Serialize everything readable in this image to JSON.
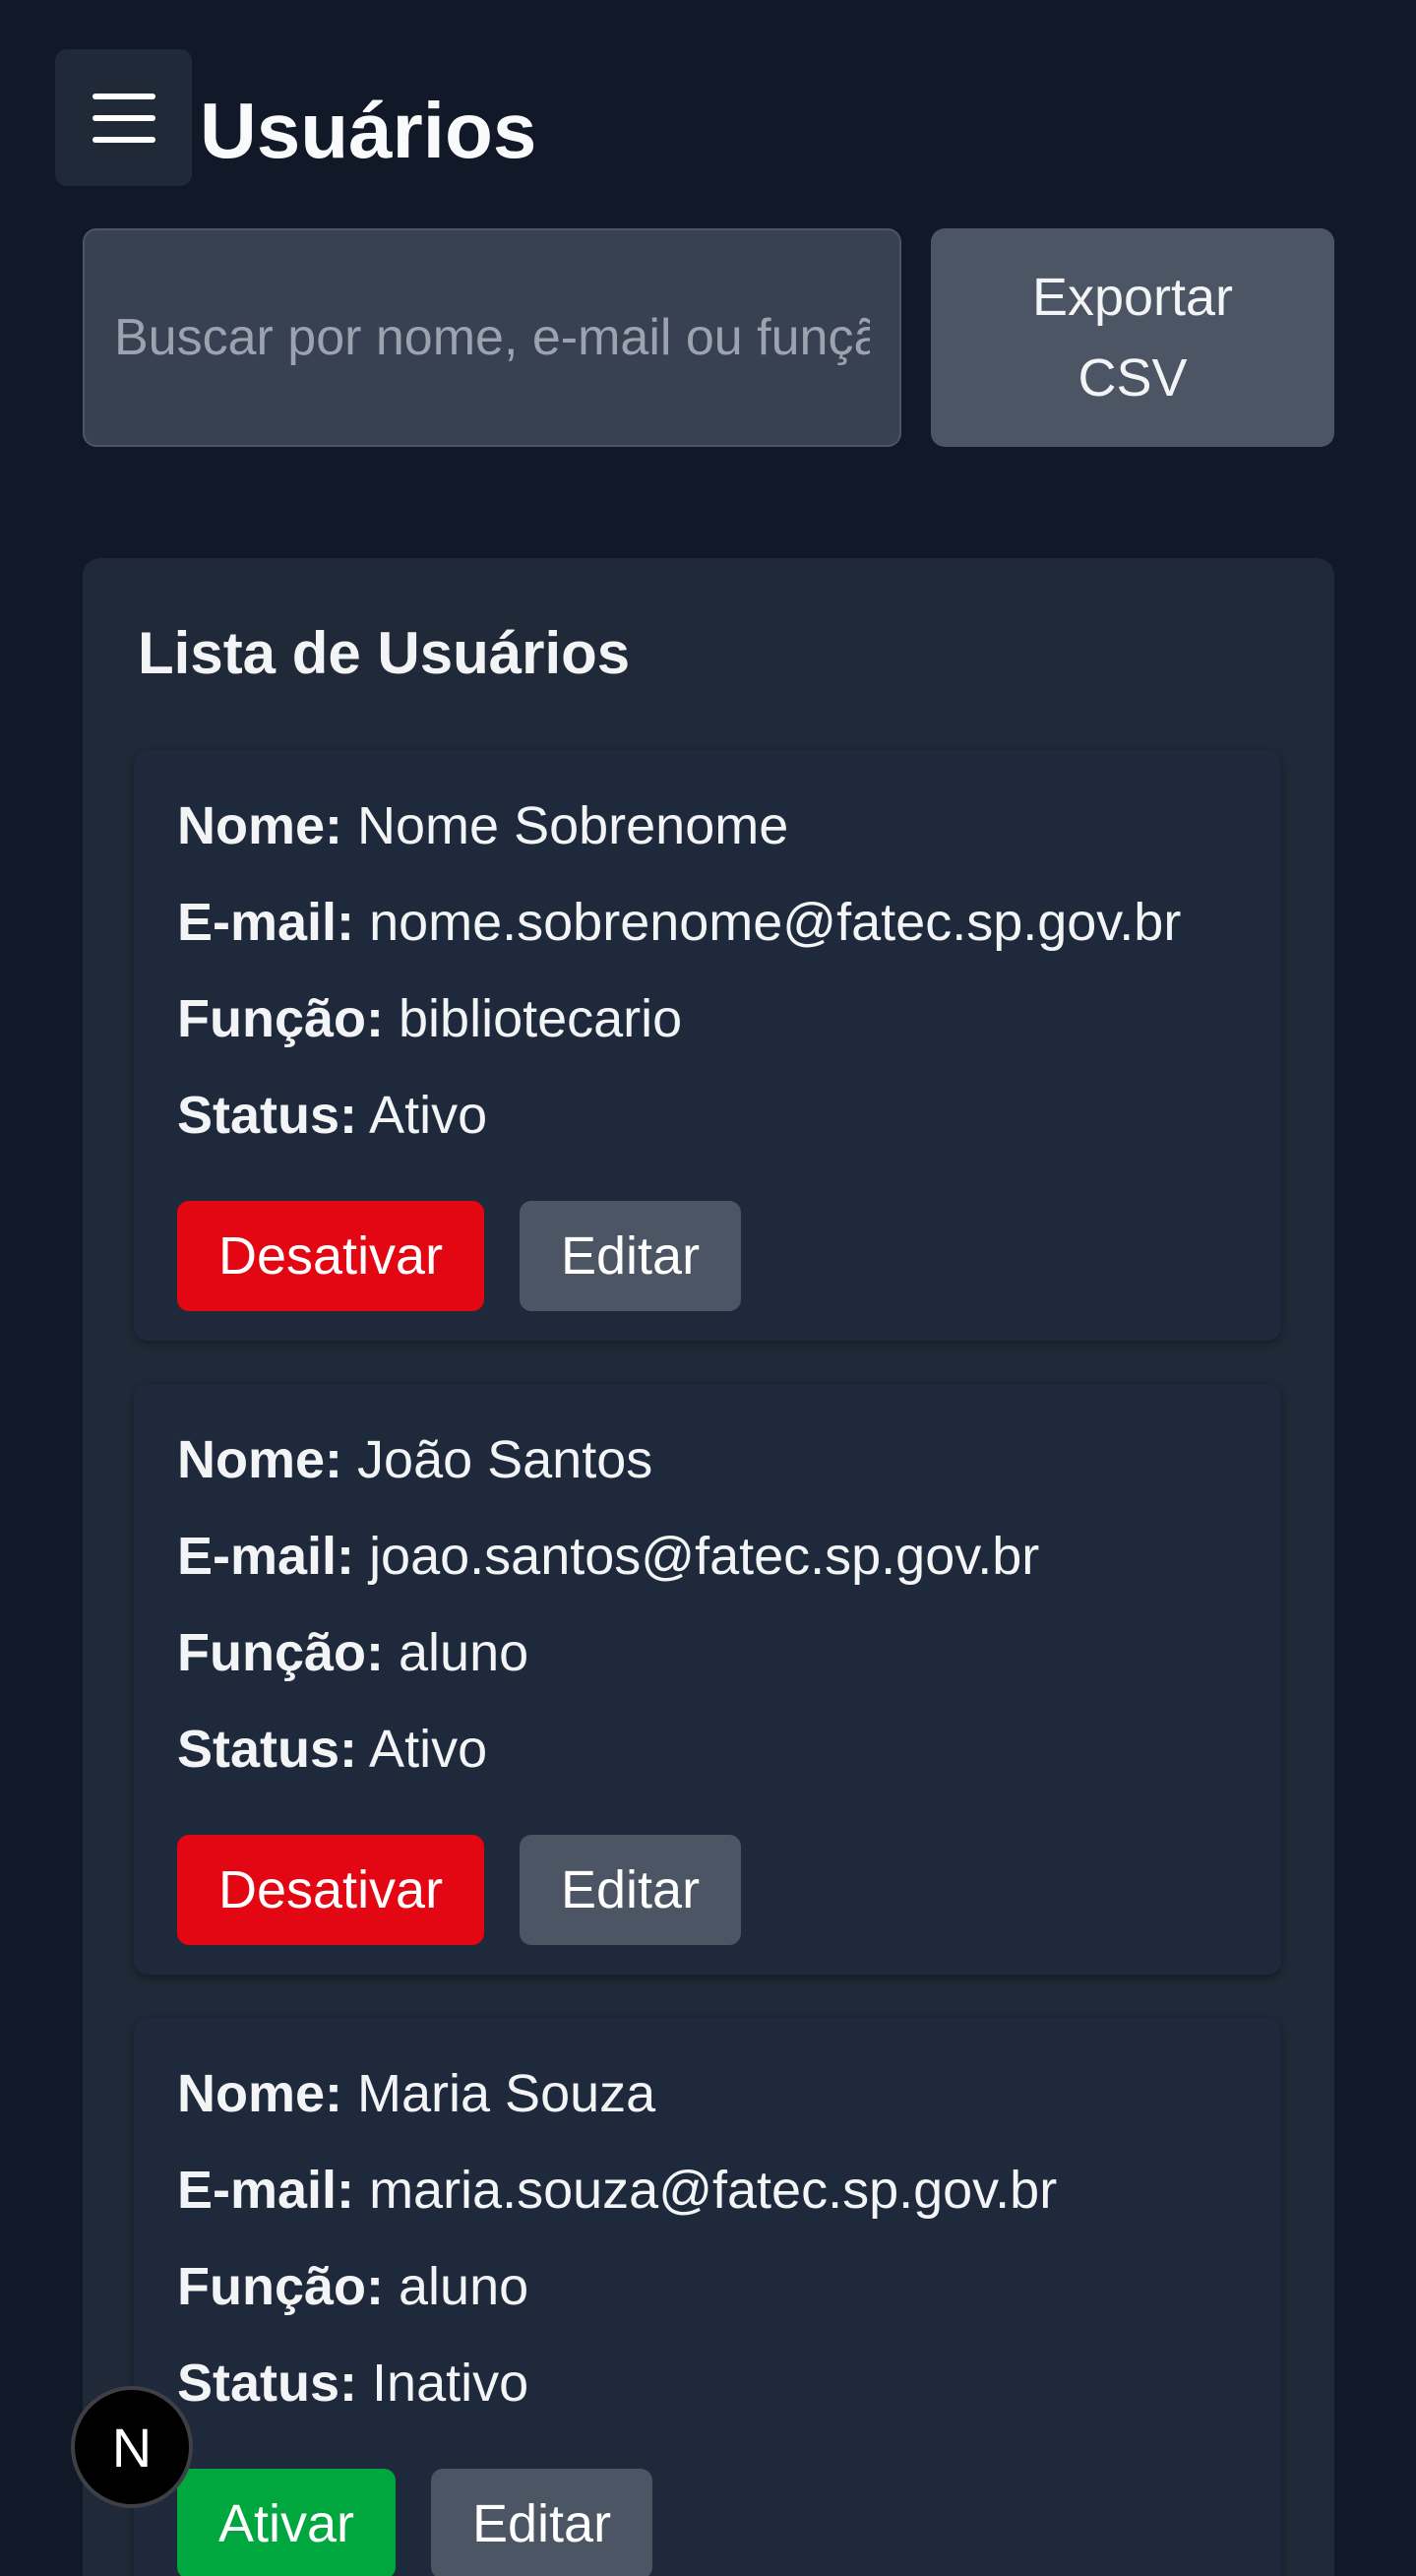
{
  "header": {
    "menu_icon": "hamburger-menu-icon",
    "title": "Usuários"
  },
  "toolbar": {
    "search_placeholder": "Buscar por nome, e-mail ou função",
    "export_label": "Exportar CSV"
  },
  "list": {
    "title": "Lista de Usuários",
    "labels": {
      "name": "Nome:",
      "email": "E-mail:",
      "role": "Função:",
      "status": "Status:"
    },
    "users": [
      {
        "name": "Nome Sobrenome",
        "email": "nome.sobrenome@fatec.sp.gov.br",
        "role": "bibliotecario",
        "status": "Ativo",
        "toggle_label": "Desativar",
        "edit_label": "Editar"
      },
      {
        "name": "João Santos",
        "email": "joao.santos@fatec.sp.gov.br",
        "role": "aluno",
        "status": "Ativo",
        "toggle_label": "Desativar",
        "edit_label": "Editar"
      },
      {
        "name": "Maria Souza",
        "email": "maria.souza@fatec.sp.gov.br",
        "role": "aluno",
        "status": "Inativo",
        "toggle_label": "Ativar",
        "edit_label": "Editar"
      }
    ]
  },
  "dev_badge": {
    "icon": "nextjs-logo-icon",
    "letter": "N"
  },
  "colors": {
    "background": "#111827",
    "panel": "#1f2937",
    "danger": "#e30613",
    "success": "#00a63e",
    "neutral_button": "#4b5563"
  }
}
